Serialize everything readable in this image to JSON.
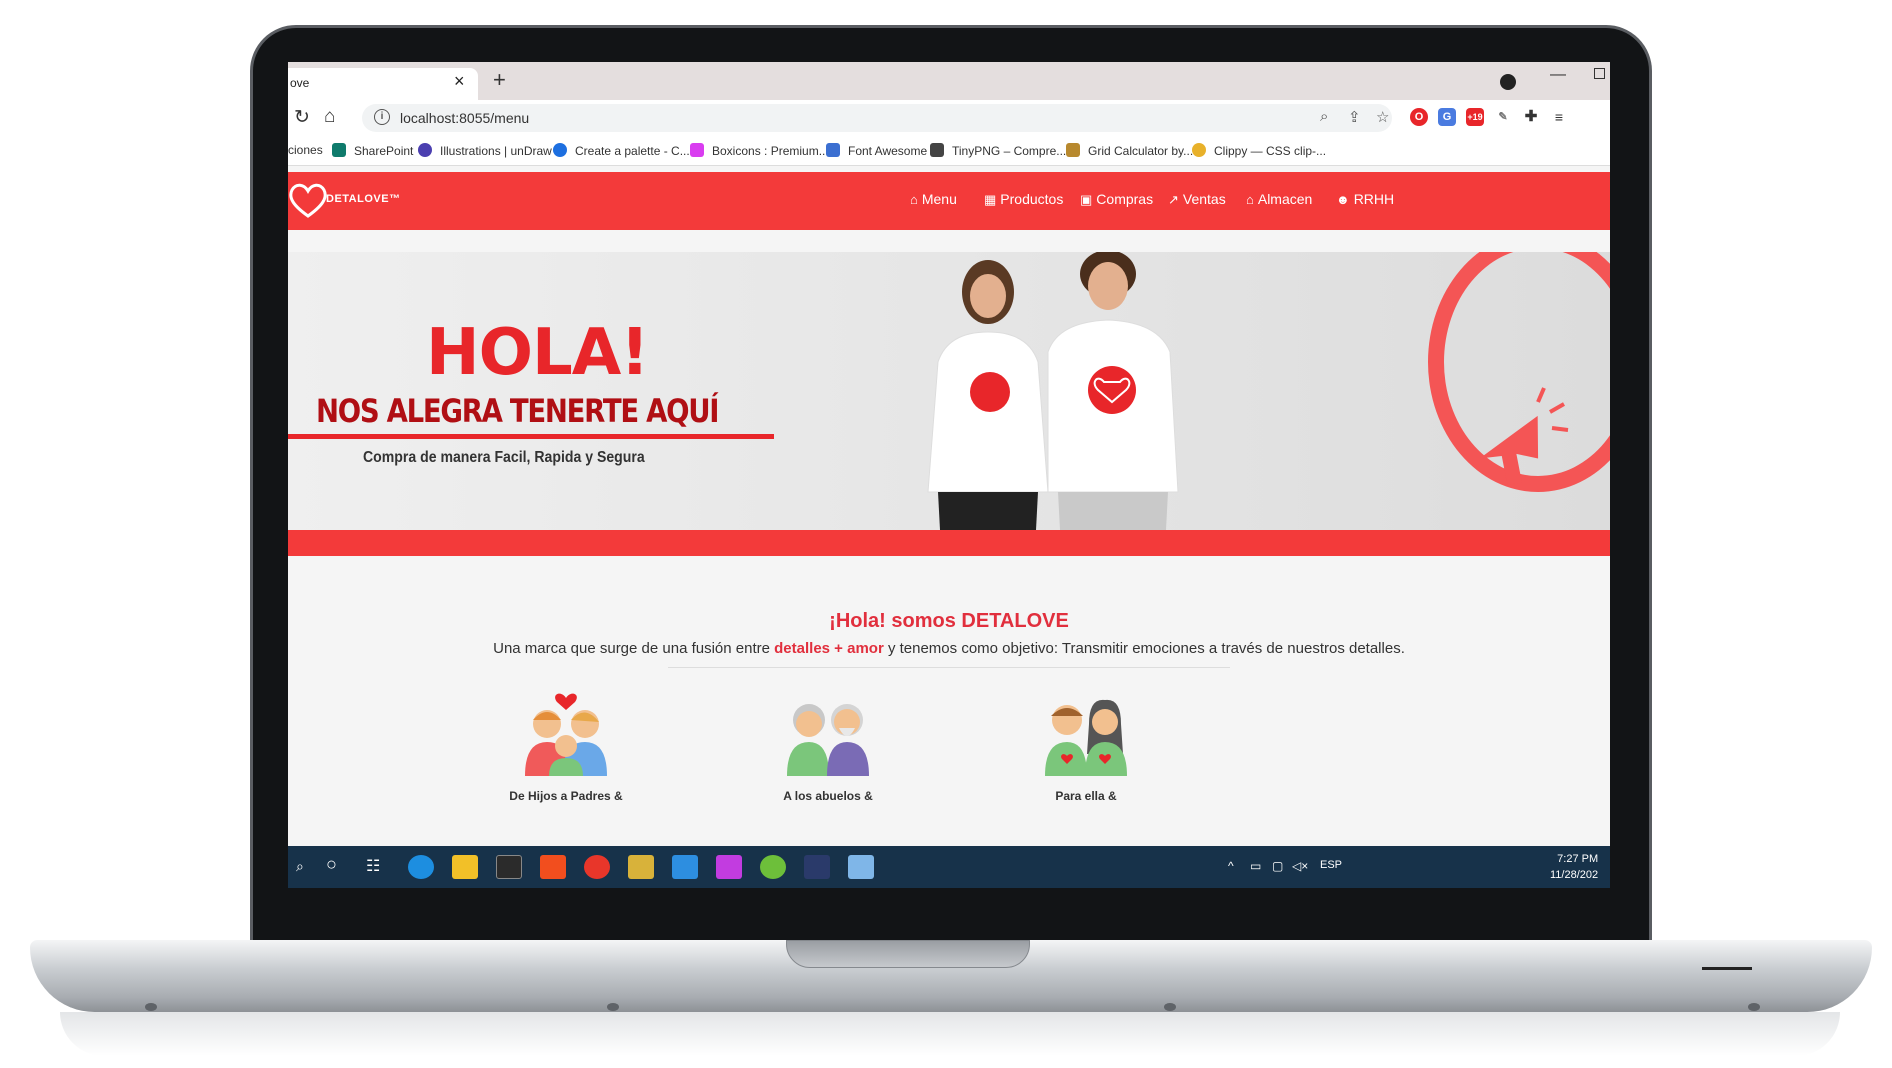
{
  "browser": {
    "tab_title": "ove",
    "tab_close": "×",
    "new_tab": "+",
    "url": "localhost:8055/menu",
    "bookmarks": [
      {
        "label": "ciones",
        "color": ""
      },
      {
        "label": "SharePoint",
        "color": "#0f7b6c"
      },
      {
        "label": "Illustrations | unDraw",
        "color": "#4b3fb0"
      },
      {
        "label": "Create a palette - C...",
        "color": "#1d6fe0"
      },
      {
        "label": "Boxicons : Premium...",
        "color": "#d93df0"
      },
      {
        "label": "Font Awesome",
        "color": "#3b6fd1"
      },
      {
        "label": "TinyPNG – Compre...",
        "color": "#444444"
      },
      {
        "label": "Grid Calculator by...",
        "color": "#b8892e"
      },
      {
        "label": "Clippy — CSS clip-...",
        "color": "#e8b12a"
      }
    ],
    "extension_badge": "+19"
  },
  "site": {
    "brand": "DETALOVE™",
    "nav": [
      {
        "label": "Menu",
        "icon": "home-icon",
        "glyph": "⌂"
      },
      {
        "label": "Productos",
        "icon": "grid-icon",
        "glyph": "▦"
      },
      {
        "label": "Compras",
        "icon": "bag-icon",
        "glyph": "▣"
      },
      {
        "label": "Ventas",
        "icon": "chart-icon",
        "glyph": "↗"
      },
      {
        "label": "Almacen",
        "icon": "warehouse-icon",
        "glyph": "⌂"
      },
      {
        "label": "RRHH",
        "icon": "users-icon",
        "glyph": "☻"
      }
    ],
    "hero": {
      "title": "HOLA!",
      "subtitle": "NOS ALEGRA TENERTE AQUÍ",
      "tagline": "Compra de manera Facil, Rapida y Segura"
    },
    "about": {
      "title": "¡Hola! somos DETALOVE",
      "text_before": "Una marca que surge de una fusión entre ",
      "highlight": "detalles + amor",
      "text_after": " y tenemos como objetivo: Transmitir emociones a través de nuestros detalles."
    },
    "cards": [
      {
        "label": "De Hijos a Padres &"
      },
      {
        "label": "A los abuelos &"
      },
      {
        "label": "Para ella &"
      }
    ]
  },
  "taskbar": {
    "tray_lang": "ESP",
    "time": "7:27 PM",
    "date": "11/28/202"
  },
  "colors": {
    "brand_red": "#f33a3a",
    "title_red": "#e12f3d",
    "taskbar": "#17324a"
  }
}
